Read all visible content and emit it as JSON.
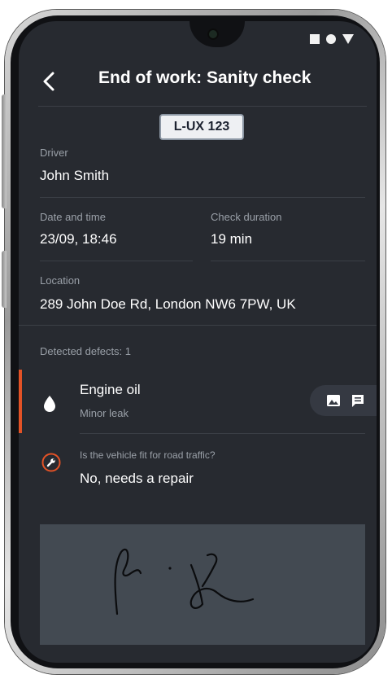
{
  "header": {
    "title": "End of work: Sanity check"
  },
  "vehicle": {
    "plate": "L-UX 123"
  },
  "details": {
    "driver_label": "Driver",
    "driver_value": "John Smith",
    "datetime_label": "Date and time",
    "datetime_value": "23/09, 18:46",
    "duration_label": "Check duration",
    "duration_value": "19 min",
    "location_label": "Location",
    "location_value": "289 John Doe Rd, London NW6 7PW, UK"
  },
  "defects": {
    "summary_label": "Detected defects: 1",
    "items": [
      {
        "title": "Engine oil",
        "subtitle": "Minor leak",
        "icon": "oil-drop-icon"
      }
    ]
  },
  "road_fitness": {
    "question": "Is the vehicle fit for road traffic?",
    "answer": "No, needs a repair",
    "icon": "wrench-icon"
  },
  "colors": {
    "background": "#272a30",
    "accent_defect": "#e35226",
    "text_primary": "#ffffff",
    "text_secondary": "#9aa0a8",
    "signature_bg": "#434a52"
  }
}
